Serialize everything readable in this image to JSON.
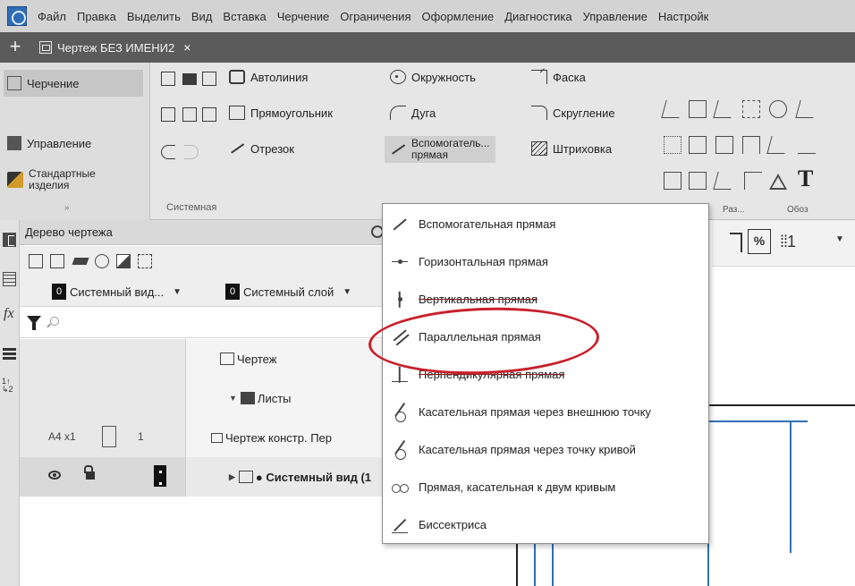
{
  "menubar": {
    "items": [
      "Файл",
      "Правка",
      "Выделить",
      "Вид",
      "Вставка",
      "Черчение",
      "Ограничения",
      "Оформление",
      "Диагностика",
      "Управление",
      "Настройк"
    ]
  },
  "tabs": {
    "active_label": "Чертеж БЕЗ ИМЕНИ2",
    "add_glyph": "+",
    "close_glyph": "×"
  },
  "ribbon": {
    "left": {
      "drawing": "Черчение",
      "management": "Управление",
      "standard_line1": "Стандартные",
      "standard_line2": "изделия",
      "collapse_glyph": "»"
    },
    "system_group_label": "Системная",
    "tools": {
      "autoline": "Автолиния",
      "rectangle": "Прямоугольник",
      "segment": "Отрезок",
      "circle": "Окружность",
      "arc": "Дуга",
      "aux_line1": "Вспомогатель...",
      "aux_line2": "прямая",
      "chamfer": "Фаска",
      "fillet": "Скругление",
      "hatch": "Штриховка"
    },
    "right_labels": {
      "dim_label": "Раз...",
      "note_label": "Обоз"
    }
  },
  "tree_panel": {
    "title": "Дерево чертежа",
    "view_select": {
      "badge": "0",
      "label": "Системный вид..."
    },
    "layer_select": {
      "badge": "0",
      "label": "Системный слой"
    },
    "search_value": "",
    "rows": {
      "drawing": "Чертеж",
      "sheets": "Листы",
      "sheet_format": "A4  x1",
      "sheet_num": "1",
      "sheet_item": "Чертеж констр. Пер",
      "system_view": "● Системный вид (1"
    }
  },
  "drawing_toolbar": {
    "grid_value": "1"
  },
  "popup_menu": {
    "items": [
      "Вспомогательная прямая",
      "Горизонтальная прямая",
      "Вертикальная прямая",
      "Параллельная прямая",
      "Перпендикулярная прямая",
      "Касательная прямая через внешнюю точку",
      "Касательная прямая через точку кривой",
      "Прямая, касательная к двум кривым",
      "Биссектриса"
    ],
    "highlighted_index": 3
  },
  "colors": {
    "menubar_bg": "#d3d3d3",
    "tabbar_bg": "#5b5b5b",
    "frame_blue": "#2f6fb7",
    "callout_red": "#c8202a"
  },
  "icons": {
    "app_logo": "kompas-logo-icon",
    "gear": "gear-icon",
    "filter": "filter-icon",
    "search": "search-icon",
    "eye": "eye-icon",
    "lock": "lock-icon"
  }
}
